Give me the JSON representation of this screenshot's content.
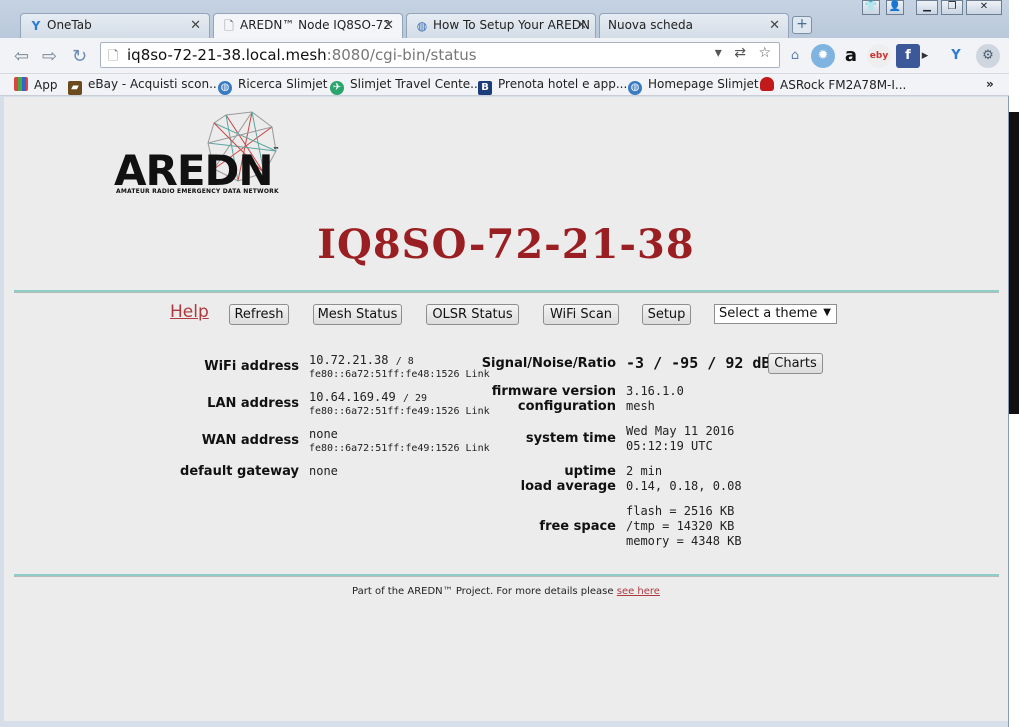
{
  "tabs": [
    {
      "title": "OneTab",
      "icon": "onetab-icon"
    },
    {
      "title": "AREDN™ Node IQ8SO-72",
      "icon": "page-icon"
    },
    {
      "title": "How To Setup Your AREDN",
      "icon": "globe-icon"
    },
    {
      "title": "Nuova scheda",
      "icon": "none"
    }
  ],
  "url": {
    "host": "iq8so-72-21-38.local.mesh",
    "rest": ":8080/cgi-bin/status"
  },
  "bookmarks": [
    {
      "label": "App",
      "icon": "apps-grid-icon"
    },
    {
      "label": "eBay - Acquisti scon...",
      "icon": "ebay-bag-icon"
    },
    {
      "label": "Ricerca Slimjet",
      "icon": "globe-icon"
    },
    {
      "label": "Slimjet Travel Cente...",
      "icon": "plane-icon"
    },
    {
      "label": "Prenota hotel e app...",
      "icon": "booking-icon"
    },
    {
      "label": "Homepage Slimjet",
      "icon": "globe-icon"
    },
    {
      "label": "ASRock FM2A78M-I...",
      "icon": "asrock-icon"
    }
  ],
  "bookmarks_more": "»",
  "logo": {
    "text": "AREDN",
    "tm": "™",
    "subtitle": "AMATEUR RADIO EMERGENCY DATA NETWORK"
  },
  "node_name": "IQ8SO-72-21-38",
  "nav": {
    "help": "Help",
    "refresh": "Refresh",
    "mesh_status": "Mesh Status",
    "olsr_status": "OLSR Status",
    "wifi_scan": "WiFi Scan",
    "setup": "Setup",
    "theme_select": "Select a theme"
  },
  "status": {
    "wifi_label": "WiFi address",
    "wifi_ip": "10.72.21.38",
    "wifi_mask": "/ 8",
    "wifi_ipv6": "fe80::6a72:51ff:fe48:1526 Link",
    "lan_label": "LAN address",
    "lan_ip": "10.64.169.49",
    "lan_mask": "/ 29",
    "lan_ipv6": "fe80::6a72:51ff:fe49:1526 Link",
    "wan_label": "WAN address",
    "wan_ip": "none",
    "wan_ipv6": "fe80::6a72:51ff:fe49:1526 Link",
    "gw_label": "default gateway",
    "gw_value": "none",
    "snr_label": "Signal/Noise/Ratio",
    "snr_value": "-3 / -95 / 92 dB",
    "charts": "Charts",
    "fw_label": "firmware version",
    "fw_value": "3.16.1.0",
    "config_label": "configuration",
    "config_value": "mesh",
    "time_label": "system time",
    "time_date": "Wed May 11 2016",
    "time_clock": "05:12:19 UTC",
    "uptime_label": "uptime",
    "uptime_value": "2 min",
    "load_label": "load average",
    "load_value": "0.14, 0.18, 0.08",
    "free_label": "free space",
    "flash": "flash = 2516 KB",
    "tmp": "/tmp = 14320 KB",
    "memory": "memory = 4348 KB"
  },
  "footer": {
    "text": "Part of the AREDN™ Project. For more details please ",
    "link": "see here"
  },
  "colors": {
    "node_name": "#9a1f23",
    "rule": "#8fcdc6",
    "link": "#b0393f"
  }
}
